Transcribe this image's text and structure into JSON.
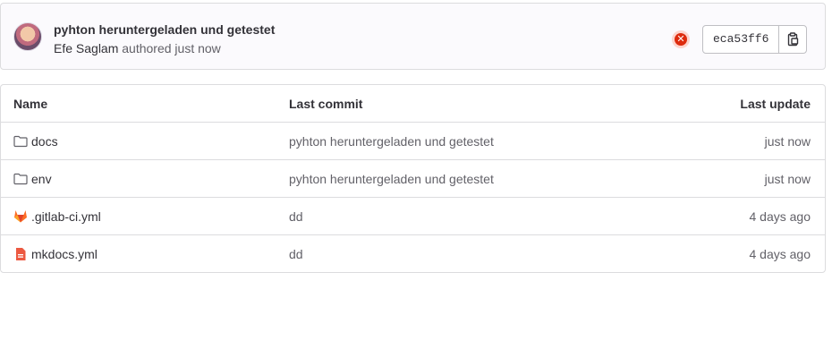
{
  "commit": {
    "title": "pyhton heruntergeladen und getestet",
    "author": "Efe Saglam",
    "authored_text": "authored just now",
    "status": "failed",
    "sha": "eca53ff6",
    "avatar_icon": "user-avatar",
    "copy_icon": "copy-to-clipboard-icon",
    "status_color": "#dd2b0e"
  },
  "table": {
    "headers": {
      "name": "Name",
      "last_commit": "Last commit",
      "last_update": "Last update"
    },
    "rows": [
      {
        "name": "docs",
        "icon": "folder-icon",
        "last_commit": "pyhton heruntergeladen und getestet",
        "last_update": "just now"
      },
      {
        "name": "env",
        "icon": "folder-icon",
        "last_commit": "pyhton heruntergeladen und getestet",
        "last_update": "just now"
      },
      {
        "name": ".gitlab-ci.yml",
        "icon": "gitlab-icon",
        "last_commit": "dd",
        "last_update": "4 days ago"
      },
      {
        "name": "mkdocs.yml",
        "icon": "file-icon",
        "last_commit": "dd",
        "last_update": "4 days ago"
      }
    ]
  }
}
